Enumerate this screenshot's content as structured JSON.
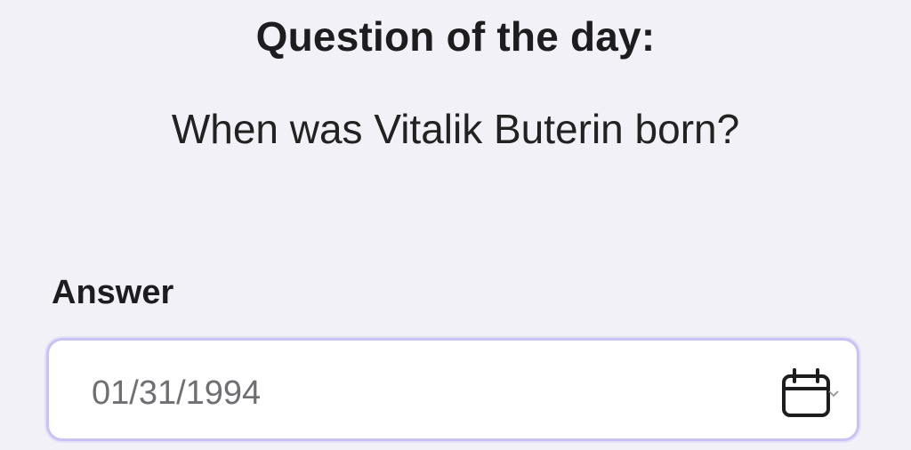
{
  "header": {
    "title": "Question of the day:",
    "question": "When was Vitalik Buterin born?"
  },
  "answer": {
    "label": "Answer",
    "value": "01/31/1994",
    "picker_icon": "calendar-icon",
    "dropdown_icon": "chevron-down-icon"
  },
  "colors": {
    "background": "#f2f1f7",
    "field_border": "#c9c2f4",
    "field_text": "#6e6e73"
  }
}
